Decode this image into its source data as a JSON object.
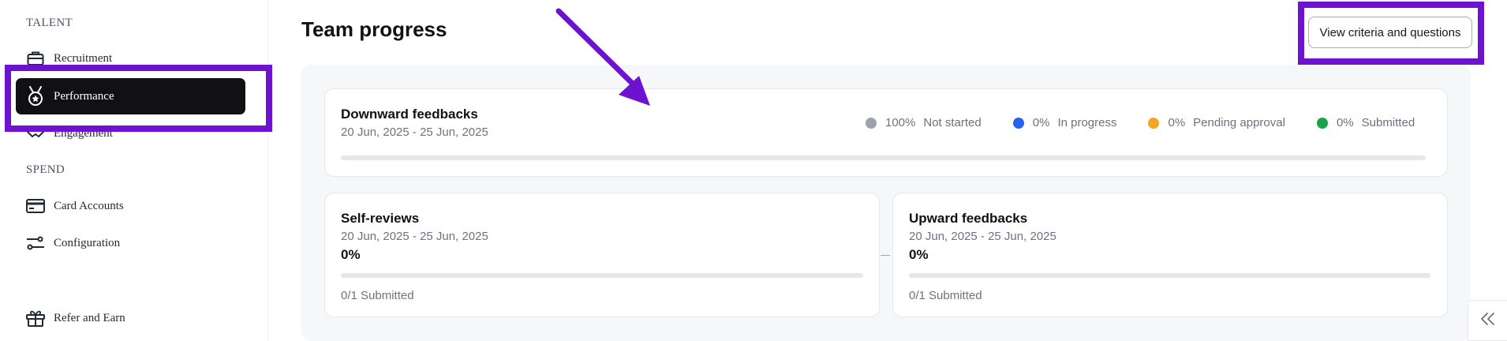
{
  "sidebar": {
    "talent_label": "TALENT",
    "spend_label": "SPEND",
    "items": {
      "recruitment": {
        "label": "Recruitment",
        "icon": "briefcase-icon"
      },
      "performance": {
        "label": "Performance",
        "icon": "medal-icon",
        "active": true
      },
      "engagement": {
        "label": "Engagement",
        "icon": "handshake-icon"
      },
      "card_accounts": {
        "label": "Card Accounts",
        "icon": "credit-card-icon"
      },
      "configuration": {
        "label": "Configuration",
        "icon": "sliders-icon"
      },
      "refer_and_earn": {
        "label": "Refer and Earn",
        "icon": "gift-icon"
      }
    }
  },
  "main": {
    "title": "Team progress",
    "criteria_button": "View criteria and questions",
    "downward": {
      "title": "Downward feedbacks",
      "date_range": "20 Jun, 2025 - 25 Jun, 2025",
      "progress": 0,
      "legend": [
        {
          "pct": "100%",
          "label": "Not started",
          "color": "#9ca3af"
        },
        {
          "pct": "0%",
          "label": "In progress",
          "color": "#2563eb"
        },
        {
          "pct": "0%",
          "label": "Pending approval",
          "color": "#f5a524"
        },
        {
          "pct": "0%",
          "label": "Submitted",
          "color": "#16a34a"
        }
      ]
    },
    "self_reviews": {
      "title": "Self-reviews",
      "date_range": "20 Jun, 2025 - 25 Jun, 2025",
      "percent": "0%",
      "progress": 0,
      "submitted": "0/1 Submitted"
    },
    "upward": {
      "title": "Upward feedbacks",
      "date_range": "20 Jun, 2025 - 25 Jun, 2025",
      "percent": "0%",
      "progress": 0,
      "submitted": "0/1 Submitted"
    }
  },
  "colors": {
    "annotation": "#6d12cf",
    "active_nav": "#111114"
  }
}
